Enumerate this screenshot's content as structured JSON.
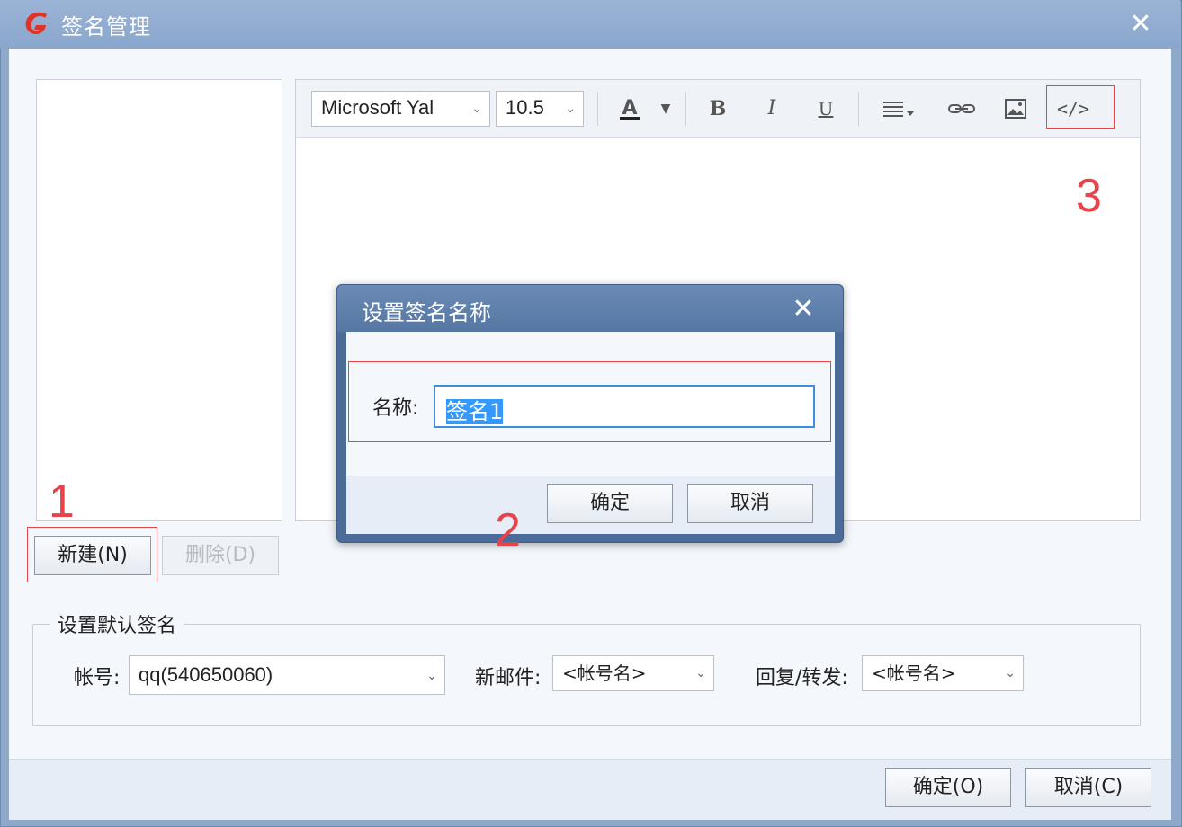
{
  "window": {
    "title": "签名管理",
    "close": "✕"
  },
  "toolbar": {
    "font_family": "Microsoft Yal",
    "font_size": "10.5",
    "font_color_icon": "A",
    "bold": "B",
    "italic": "I",
    "underline": "U",
    "html_source": "</>"
  },
  "left": {
    "new_label": "新建(N)",
    "delete_label": "删除(D)"
  },
  "default_signature": {
    "group_title": "设置默认签名",
    "account_label": "帐号:",
    "account_value": "qq(540650060)",
    "new_mail_label": "新邮件:",
    "new_mail_value": "<帐号名>",
    "reply_label": "回复/转发:",
    "reply_value": "<帐号名>"
  },
  "footer": {
    "ok_label": "确定(O)",
    "cancel_label": "取消(C)"
  },
  "modal": {
    "title": "设置签名名称",
    "close": "✕",
    "name_label": "名称:",
    "name_value": "签名1",
    "ok_label": "确定",
    "cancel_label": "取消"
  },
  "annotations": {
    "mark1": "1",
    "mark2": "2",
    "mark3": "3"
  },
  "colors": {
    "title_bar": "#8fa9cb",
    "annotation_red": "#e8434b",
    "selection": "#3399ff",
    "client_bg": "#f4f7fc"
  },
  "icons": [
    "app-logo-icon",
    "close-icon",
    "chevron-down-icon",
    "font-color-icon",
    "align-icon",
    "link-icon",
    "image-icon",
    "html-source-icon"
  ]
}
